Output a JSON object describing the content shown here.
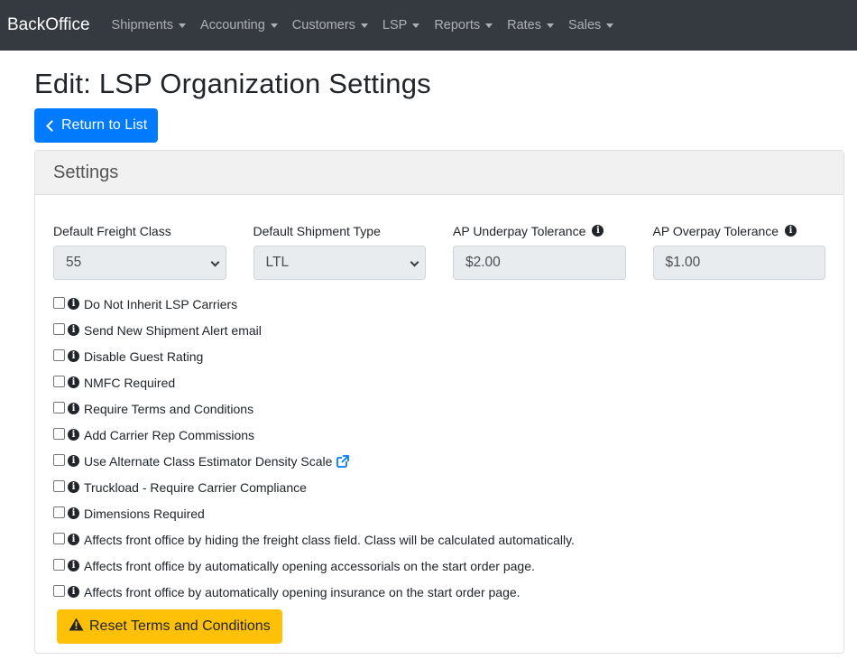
{
  "navbar": {
    "brand": "BackOffice",
    "items": [
      {
        "label": "Shipments"
      },
      {
        "label": "Accounting"
      },
      {
        "label": "Customers"
      },
      {
        "label": "LSP"
      },
      {
        "label": "Reports"
      },
      {
        "label": "Rates"
      },
      {
        "label": "Sales"
      }
    ]
  },
  "page": {
    "title": "Edit: LSP Organization Settings",
    "return_label": "Return to List"
  },
  "settings": {
    "header": "Settings",
    "fields": {
      "freight_class": {
        "label": "Default Freight Class",
        "value": "55"
      },
      "shipment_type": {
        "label": "Default Shipment Type",
        "value": "LTL"
      },
      "ap_underpay": {
        "label": "AP Underpay Tolerance",
        "value": "$2.00"
      },
      "ap_overpay": {
        "label": "AP Overpay Tolerance",
        "value": "$1.00"
      }
    },
    "checkboxes": [
      {
        "label": "Do Not Inherit LSP Carriers",
        "checked": false
      },
      {
        "label": "Send New Shipment Alert email",
        "checked": false
      },
      {
        "label": "Disable Guest Rating",
        "checked": false
      },
      {
        "label": "NMFC Required",
        "checked": false
      },
      {
        "label": "Require Terms and Conditions",
        "checked": false
      },
      {
        "label": "Add Carrier Rep Commissions",
        "checked": false
      },
      {
        "label": "Use Alternate Class Estimator Density Scale",
        "checked": false
      },
      {
        "label": "Truckload - Require Carrier Compliance",
        "checked": false
      },
      {
        "label": "Dimensions Required",
        "checked": false
      },
      {
        "label": "Affects front office by hiding the freight class field. Class will be calculated automatically.",
        "checked": false
      },
      {
        "label": "Affects front office by automatically opening accessorials on the start order page.",
        "checked": false
      },
      {
        "label": "Affects front office by automatically opening insurance on the start order page.",
        "checked": false
      }
    ],
    "reset_label": "Reset Terms and Conditions"
  },
  "colors": {
    "navbar": "#343a40",
    "primary": "#007bff",
    "warning": "#ffc107",
    "link": "#007bff"
  }
}
